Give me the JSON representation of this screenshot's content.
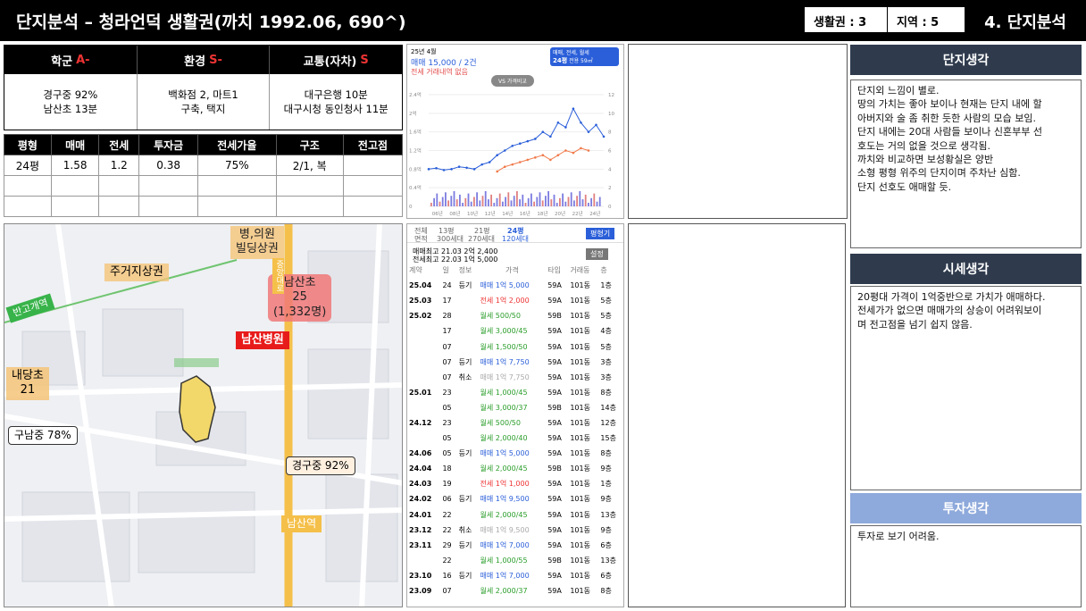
{
  "header": {
    "title": "단지분석 – 청라언덕 생활권(까치 1992.06, 690^)",
    "badge1": "생활권 : 3",
    "badge2": "지역  : 5",
    "page": "4. 단지분석"
  },
  "grades": {
    "school_label": "학군",
    "school_grade": "A-",
    "env_label": "환경",
    "env_grade": "S-",
    "traffic_label": "교통(자차)",
    "traffic_grade": "S",
    "school_detail": "경구중 92%\n남산초 13분",
    "env_detail": "백화점 2, 마트1\n구축, 택지",
    "traffic_detail": "대구은행 10분\n대구시청 동인청사 11분"
  },
  "price_table": {
    "headers": [
      "평형",
      "매매",
      "전세",
      "투자금",
      "전세가율",
      "구조",
      "전고점"
    ],
    "rows": [
      [
        "24평",
        "1.58",
        "1.2",
        "0.38",
        "75%",
        "2/1, 복",
        ""
      ],
      [
        "",
        "",
        "",
        "",
        "",
        "",
        ""
      ],
      [
        "",
        "",
        "",
        "",
        "",
        "",
        ""
      ]
    ]
  },
  "map": {
    "hospital": "병,의원\n빌딩상권",
    "residential": "주거지상권",
    "elem1": "남산초\n25\n(1,332명)",
    "hospital_main": "남산병원",
    "station1": "반고개역",
    "elem2": "내당초\n21",
    "middle1": "구남중 78%",
    "middle2": "경구중 92%",
    "station2": "남산역",
    "road": "중앙대로"
  },
  "chart_panel": {
    "period": "25년 4월",
    "summary": "매매 15,000 / 2건",
    "none": "전세 거래내역 없음",
    "compare": "VS 가격비교",
    "filter": "매매, 전세, 월세",
    "filter2": "24평",
    "filter3": "전용 59㎡"
  },
  "chart_data": {
    "type": "line",
    "x_ticks": [
      "06년",
      "08년",
      "10년",
      "12년",
      "14년",
      "16년",
      "18년",
      "20년",
      "22년",
      "24년"
    ],
    "y_left_ticks": [
      "0",
      "0.4억",
      "0.8억",
      "1.2억",
      "1.6억",
      "2억",
      "2.4억"
    ],
    "y_right_ticks": [
      "0",
      "2",
      "4",
      "6",
      "8",
      "10",
      "12"
    ],
    "ylim": [
      0,
      2.4
    ],
    "series": [
      {
        "values": [
          0.8,
          0.82,
          0.78,
          0.8,
          0.85,
          0.83,
          0.8,
          0.9,
          0.95,
          1.1,
          1.2,
          1.3,
          1.35,
          1.4,
          1.45,
          1.6,
          1.5,
          1.8,
          1.7,
          2.1,
          1.8,
          1.6,
          1.75,
          1.5
        ]
      },
      {
        "values": [
          null,
          null,
          null,
          null,
          null,
          null,
          null,
          null,
          null,
          0.75,
          0.85,
          0.9,
          0.95,
          1.0,
          1.05,
          1.1,
          1.0,
          1.1,
          1.2,
          1.15,
          1.25,
          1.2,
          null,
          null
        ]
      }
    ]
  },
  "trade": {
    "area_label": "전체",
    "area2": "13평",
    "area3": "21평",
    "area4": "24평",
    "households": "300세대",
    "households2": "270세대",
    "households3": "120세대",
    "row_label1": "면적",
    "max1": "매매최고 21.03 2억 2,400",
    "max2": "전세최고 22.03 1억 5,000",
    "btn": "평형기",
    "btn2": "설정",
    "cols": [
      "계약",
      "일",
      "정보",
      "가격",
      "타입",
      "거래동",
      "층"
    ],
    "rows": [
      [
        "25.04",
        "24",
        "등기",
        "매매 1억 5,000",
        "59A",
        "101동",
        "1층"
      ],
      [
        "25.03",
        "17",
        "",
        "전세 1억 2,000",
        "59A",
        "101동",
        "5층"
      ],
      [
        "25.02",
        "28",
        "",
        "월세 500/50",
        "59B",
        "101동",
        "5층"
      ],
      [
        "",
        "17",
        "",
        "월세 3,000/45",
        "59A",
        "101동",
        "4층"
      ],
      [
        "",
        "07",
        "",
        "월세 1,500/50",
        "59A",
        "101동",
        "5층"
      ],
      [
        "",
        "07",
        "등기",
        "매매 1억 7,750",
        "59A",
        "101동",
        "3층"
      ],
      [
        "",
        "07",
        "취소",
        "매매 1억 7,750",
        "59A",
        "101동",
        "3층"
      ],
      [
        "25.01",
        "23",
        "",
        "월세 1,000/45",
        "59A",
        "101동",
        "8층"
      ],
      [
        "",
        "05",
        "",
        "월세 3,000/37",
        "59B",
        "101동",
        "14층"
      ],
      [
        "24.12",
        "23",
        "",
        "월세 500/50",
        "59A",
        "101동",
        "12층"
      ],
      [
        "",
        "05",
        "",
        "월세 2,000/40",
        "59A",
        "101동",
        "15층"
      ],
      [
        "24.06",
        "05",
        "등기",
        "매매 1억 5,000",
        "59A",
        "101동",
        "8층"
      ],
      [
        "24.04",
        "18",
        "",
        "월세 2,000/45",
        "59B",
        "101동",
        "9층"
      ],
      [
        "24.03",
        "19",
        "",
        "전세 1억 1,000",
        "59A",
        "101동",
        "1층"
      ],
      [
        "24.02",
        "06",
        "등기",
        "매매 1억 9,500",
        "59A",
        "101동",
        "9층"
      ],
      [
        "24.01",
        "22",
        "",
        "월세 2,000/45",
        "59A",
        "101동",
        "13층"
      ],
      [
        "23.12",
        "22",
        "취소",
        "매매 1억 9,500",
        "59A",
        "101동",
        "9층"
      ],
      [
        "23.11",
        "29",
        "등기",
        "매매 1억 7,000",
        "59A",
        "101동",
        "6층"
      ],
      [
        "",
        "22",
        "",
        "월세 1,000/55",
        "59B",
        "101동",
        "13층"
      ],
      [
        "23.10",
        "16",
        "등기",
        "매매 1억 7,000",
        "59A",
        "101동",
        "6층"
      ],
      [
        "23.09",
        "07",
        "",
        "월세 2,000/37",
        "59A",
        "101동",
        "8층"
      ]
    ]
  },
  "sections": {
    "s1_title": "단지생각",
    "s1_text": "단지외 느낌이 별로.\n땅의 가치는 좋아 보이나 현재는 단지 내에 할\n아버지와 술 좀 취한 듯한 사람의 모습 보임.\n단지 내에는 20대 사람들 보이나 신혼부부 선\n호도는 거의 없을 것으로 생각됨.\n까치와 비교하면 보성황실은 양반\n소형 평형 위주의 단지이며 주차난 심함.\n단지 선호도 애매할 듯.",
    "s2_title": "시세생각",
    "s2_text": "20평대 가격이 1억중반으로 가치가 애매하다.\n전세가가 없으면 매매가의 상승이 어려워보이\n며 전고점을 넘기 쉽지 않음.",
    "s3_title": "투자생각",
    "s3_text": "투자로 보기 어려움."
  },
  "colors": {
    "black": "#000000",
    "accent_red": "#e33333",
    "navy": "#2f3b4d",
    "blue_head": "#8ea9db"
  }
}
